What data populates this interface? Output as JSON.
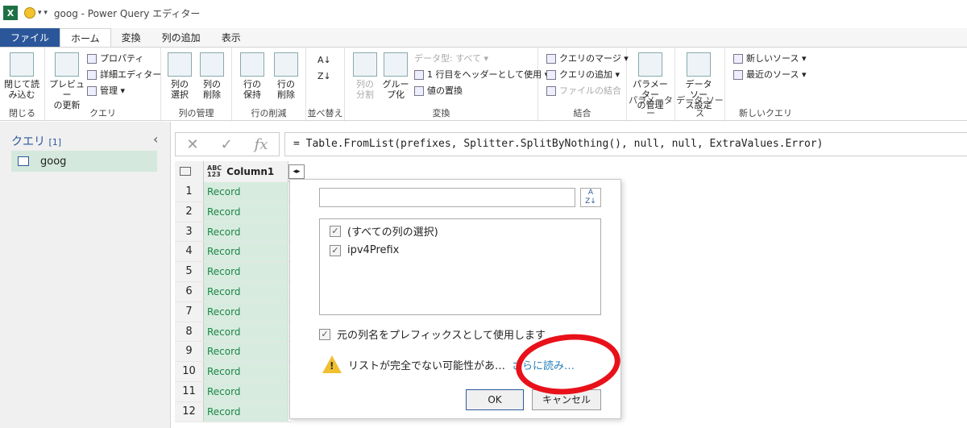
{
  "window": {
    "title": "goog - Power Query エディター"
  },
  "tabs": [
    "ファイル",
    "ホーム",
    "変換",
    "列の追加",
    "表示"
  ],
  "ribbon": {
    "close_load": "閉じて読\nみ込む",
    "close_group": "閉じる",
    "preview": "プレビュー\nの更新",
    "properties": "プロパティ",
    "advanced_editor": "詳細エディター",
    "manage": "管理",
    "query_group": "クエリ",
    "choose_cols": "列の\n選択",
    "remove_cols": "列の\n削除",
    "manage_cols_group": "列の管理",
    "keep_rows": "行の\n保持",
    "remove_rows": "行の\n削除",
    "reduce_rows_group": "行の削減",
    "sort_group": "並べ替え",
    "split_col": "列の\n分割",
    "group_by": "グルー\nプ化",
    "data_type": "データ型: すべて",
    "first_row_header": "1 行目をヘッダーとして使用",
    "replace_values": "値の置換",
    "transform_group": "変換",
    "merge_queries": "クエリのマージ",
    "append_queries": "クエリの追加",
    "combine_files": "ファイルの結合",
    "combine_group": "結合",
    "manage_params": "パラメーター\nの管理",
    "params_group": "パラメーター",
    "datasource_settings": "データ ソー\nス設定",
    "datasource_group": "データ ソース",
    "new_source": "新しいソース",
    "recent_sources": "最近のソース",
    "new_query_group": "新しいクエリ"
  },
  "sidebar": {
    "title": "クエリ",
    "count": "[1]",
    "items": [
      {
        "label": "goog"
      }
    ]
  },
  "formula": "= Table.FromList(prefixes, Splitter.SplitByNothing(), null, null, ExtraValues.Error)",
  "grid": {
    "column_type": "ABC\n123",
    "column_name": "Column1",
    "rows": [
      {
        "n": "1",
        "v": "Record"
      },
      {
        "n": "2",
        "v": "Record"
      },
      {
        "n": "3",
        "v": "Record"
      },
      {
        "n": "4",
        "v": "Record"
      },
      {
        "n": "5",
        "v": "Record"
      },
      {
        "n": "6",
        "v": "Record"
      },
      {
        "n": "7",
        "v": "Record"
      },
      {
        "n": "8",
        "v": "Record"
      },
      {
        "n": "9",
        "v": "Record"
      },
      {
        "n": "10",
        "v": "Record"
      },
      {
        "n": "11",
        "v": "Record"
      },
      {
        "n": "12",
        "v": "Record"
      }
    ]
  },
  "popup": {
    "select_all": "(すべての列の選択)",
    "columns": [
      "ipv4Prefix"
    ],
    "use_prefix": "元の列名をプレフィックスとして使用します",
    "warning": "リストが完全でない可能性があ…",
    "load_more": "さらに読み…",
    "ok": "OK",
    "cancel": "キャンセル"
  }
}
